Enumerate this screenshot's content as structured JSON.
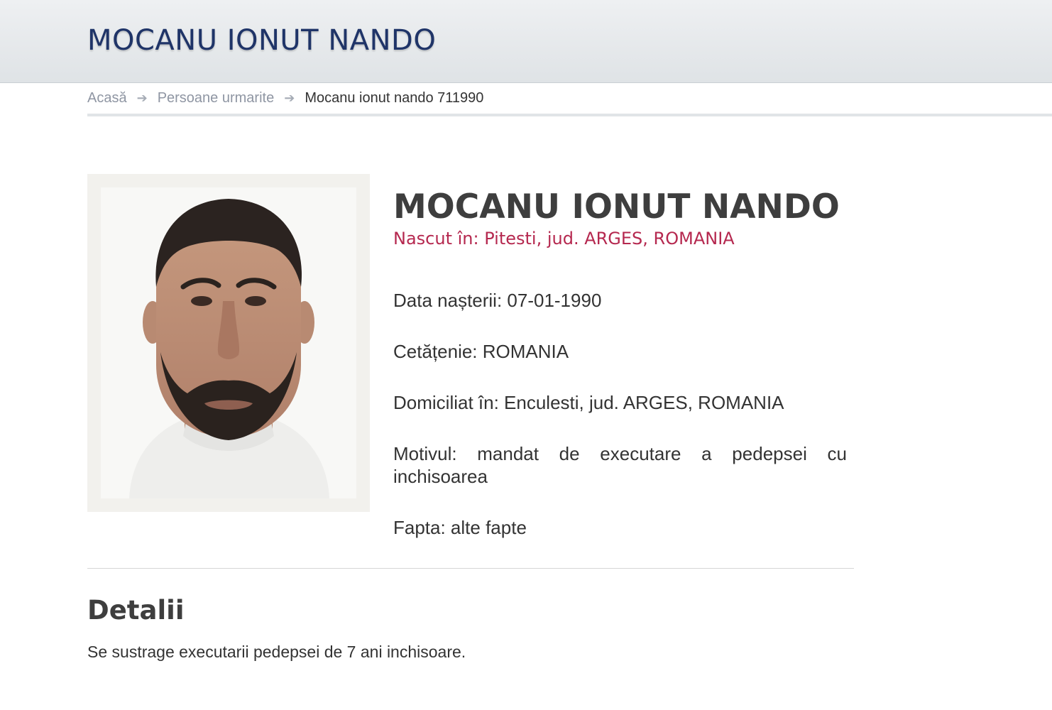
{
  "header": {
    "title": "MOCANU IONUT NANDO"
  },
  "breadcrumb": {
    "items": [
      {
        "label": "Acasă"
      },
      {
        "label": "Persoane urmarite"
      },
      {
        "label": "Mocanu ionut nando 711990"
      }
    ],
    "separator": "➔"
  },
  "profile": {
    "name": "MOCANU IONUT NANDO",
    "born": "Nascut în: Pitesti, jud. ARGES, ROMANIA",
    "fields": {
      "birth_date": "Data nașterii: 07-01-1990",
      "citizenship": "Cetățenie: ROMANIA",
      "residence": "Domiciliat în: Enculesti, jud. ARGES, ROMANIA",
      "reason": "Motivul: mandat de executare a pedepsei cu inchisoarea",
      "deed": "Fapta: alte fapte"
    }
  },
  "details": {
    "heading": "Detalii",
    "text": "Se sustrage executarii pedepsei de 7 ani inchisoare."
  },
  "colors": {
    "header_title": "#1f3468",
    "born_accent": "#b5284f",
    "heading_text": "#3e3e3e"
  }
}
